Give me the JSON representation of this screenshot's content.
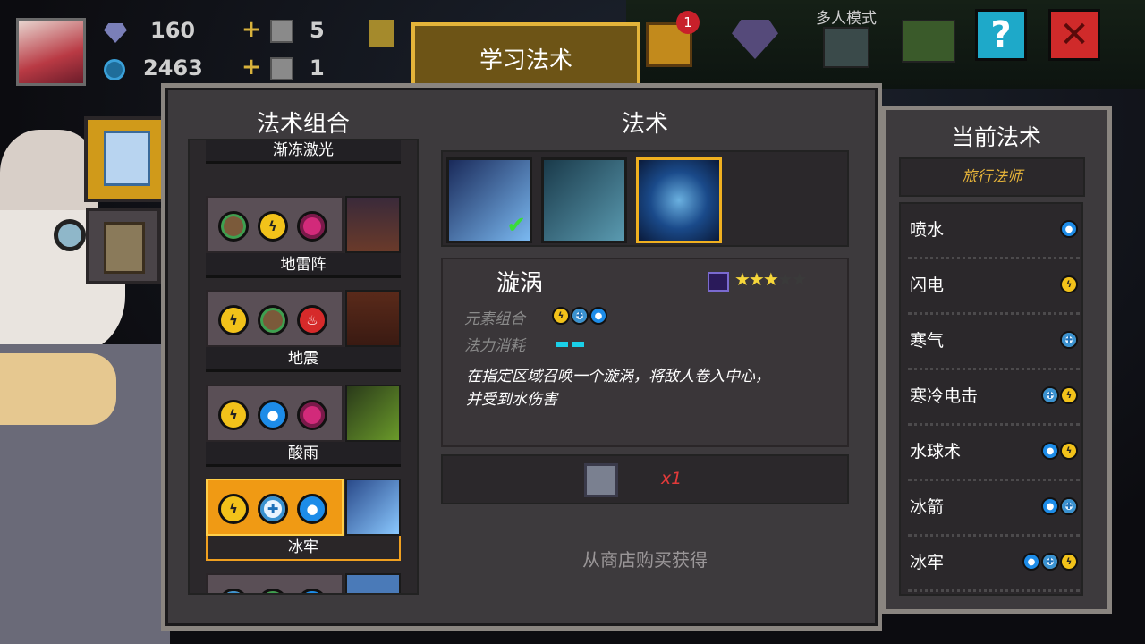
{
  "hud": {
    "gems": "160",
    "coins": "2463",
    "item1_count": "5",
    "item2_count": "1",
    "chest_badge": "1",
    "mode_label": "多人模式"
  },
  "learn_tab": "学习法术",
  "left_panel": {
    "title": "法术组合",
    "combos": [
      {
        "name": "渐冻激光",
        "elements": []
      },
      {
        "name": "地雷阵",
        "elements": [
          "earth",
          "thunder",
          "poison"
        ]
      },
      {
        "name": "地震",
        "elements": [
          "thunder",
          "earth",
          "fire"
        ]
      },
      {
        "name": "酸雨",
        "elements": [
          "thunder",
          "water",
          "poison"
        ]
      },
      {
        "name": "冰牢",
        "elements": [
          "thunder",
          "ice",
          "water"
        ],
        "selected": true
      },
      {
        "name": "",
        "elements": [
          "ice",
          "earth",
          "water"
        ]
      }
    ]
  },
  "spell_panel": {
    "title": "法术",
    "spell_name": "漩涡",
    "stars": 3,
    "stars_max": 5,
    "element_label": "元素组合",
    "mana_label": "法力消耗",
    "description_line1": "在指定区域召唤一个漩涡，将敌人卷入中心，",
    "description_line2": "并受到水伤害",
    "cost_multiplier": "x1",
    "acquire_text": "从商店购买获得"
  },
  "right_panel": {
    "title": "当前法术",
    "class_name": "旅行法师",
    "spells": [
      {
        "name": "喷水",
        "elements": [
          "water"
        ]
      },
      {
        "name": "闪电",
        "elements": [
          "thunder"
        ]
      },
      {
        "name": "寒气",
        "elements": [
          "ice"
        ]
      },
      {
        "name": "寒冷电击",
        "elements": [
          "ice",
          "thunder"
        ]
      },
      {
        "name": "水球术",
        "elements": [
          "water",
          "thunder"
        ]
      },
      {
        "name": "冰箭",
        "elements": [
          "water",
          "ice"
        ]
      },
      {
        "name": "冰牢",
        "elements": [
          "water",
          "ice",
          "thunder"
        ]
      }
    ]
  },
  "colors": {
    "accent": "#e4b43a",
    "selected": "#f09a14",
    "panel": "#3d3a3d",
    "border": "#8a8580"
  }
}
